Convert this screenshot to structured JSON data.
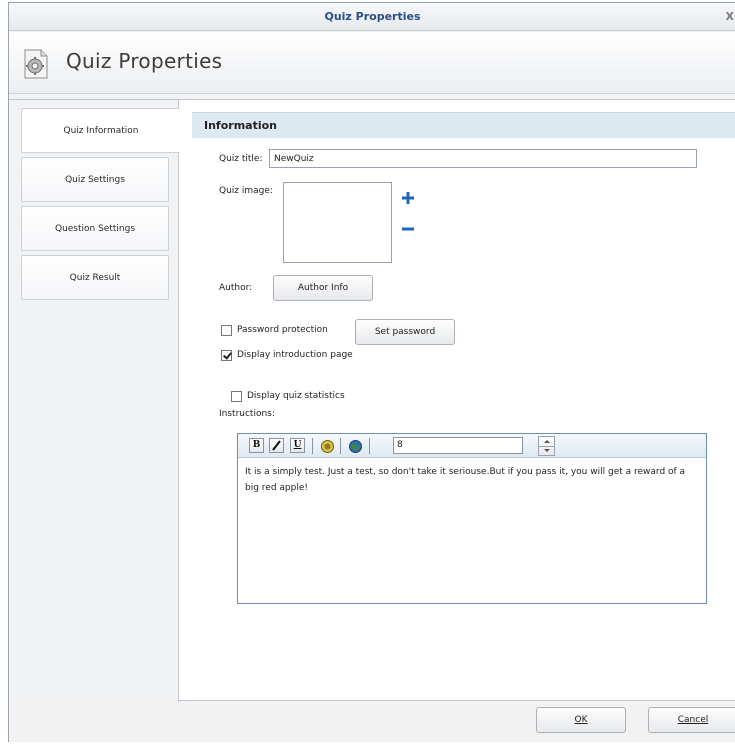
{
  "window": {
    "title": "Quiz Properties",
    "close_label": "X"
  },
  "header": {
    "title": "Quiz Properties",
    "icon": "gear-document-icon"
  },
  "sidebar": {
    "items": [
      {
        "label": "Quiz Information",
        "active": true
      },
      {
        "label": "Quiz Settings",
        "active": false
      },
      {
        "label": "Question Settings",
        "active": false
      },
      {
        "label": "Quiz Result",
        "active": false
      }
    ]
  },
  "information": {
    "heading": "Information",
    "quiz_title_label": "Quiz title:",
    "quiz_title_value": "NewQuiz",
    "quiz_image_label": "Quiz image:",
    "author_label": "Author:",
    "author_button": "Author Info",
    "password_label": "Password protection",
    "password_checked": false,
    "set_password_button": "Set password",
    "intro_label": "Display introduction page",
    "intro_checked": true,
    "stats_label": "Display quiz statistics",
    "stats_checked": false,
    "instructions_label": "Instructions:"
  },
  "editor": {
    "bold": "B",
    "italic": "I",
    "underline": "U",
    "font_size": "8",
    "text": "It is a simply test. Just a test, so don't take it seriouse.But if you pass it, you will get a reward of a big red apple!"
  },
  "footer": {
    "ok_label": "OK",
    "cancel_label": "Cancel"
  },
  "colors": {
    "accent": "#1f64b8",
    "title_text": "#2a4f86",
    "section_bg": "#dce9f1"
  }
}
